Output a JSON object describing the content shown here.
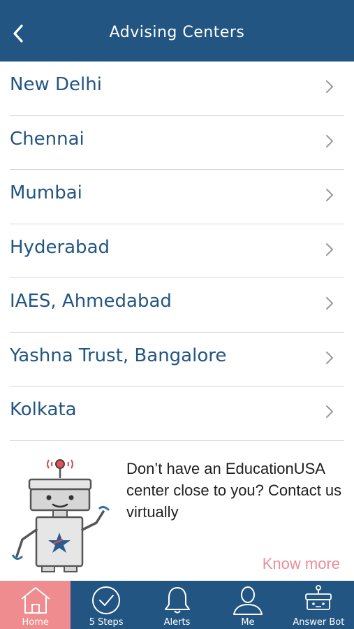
{
  "header": {
    "title": "Advising Centers",
    "back_icon": "chevron-left-icon"
  },
  "centers": [
    {
      "label": "New Delhi"
    },
    {
      "label": "Chennai"
    },
    {
      "label": "Mumbai"
    },
    {
      "label": "Hyderabad"
    },
    {
      "label": "IAES, Ahmedabad"
    },
    {
      "label": "Yashna Trust, Bangalore"
    },
    {
      "label": "Kolkata"
    }
  ],
  "promo": {
    "text": "Don’t have an EducationUSA center close to you? Contact us virtually",
    "link": "Know more"
  },
  "tabs": [
    {
      "label": "Home",
      "icon": "home-icon",
      "active": true
    },
    {
      "label": "5 Steps",
      "icon": "check-circle-icon",
      "active": false
    },
    {
      "label": "Alerts",
      "icon": "bell-icon",
      "active": false
    },
    {
      "label": "Me",
      "icon": "person-icon",
      "active": false
    },
    {
      "label": "Answer Bot",
      "icon": "robot-icon",
      "active": false
    }
  ],
  "colors": {
    "header_bg": "#235582",
    "list_text": "#235582",
    "active_tab": "#ef8c8f",
    "link": "#ea8e9a"
  }
}
